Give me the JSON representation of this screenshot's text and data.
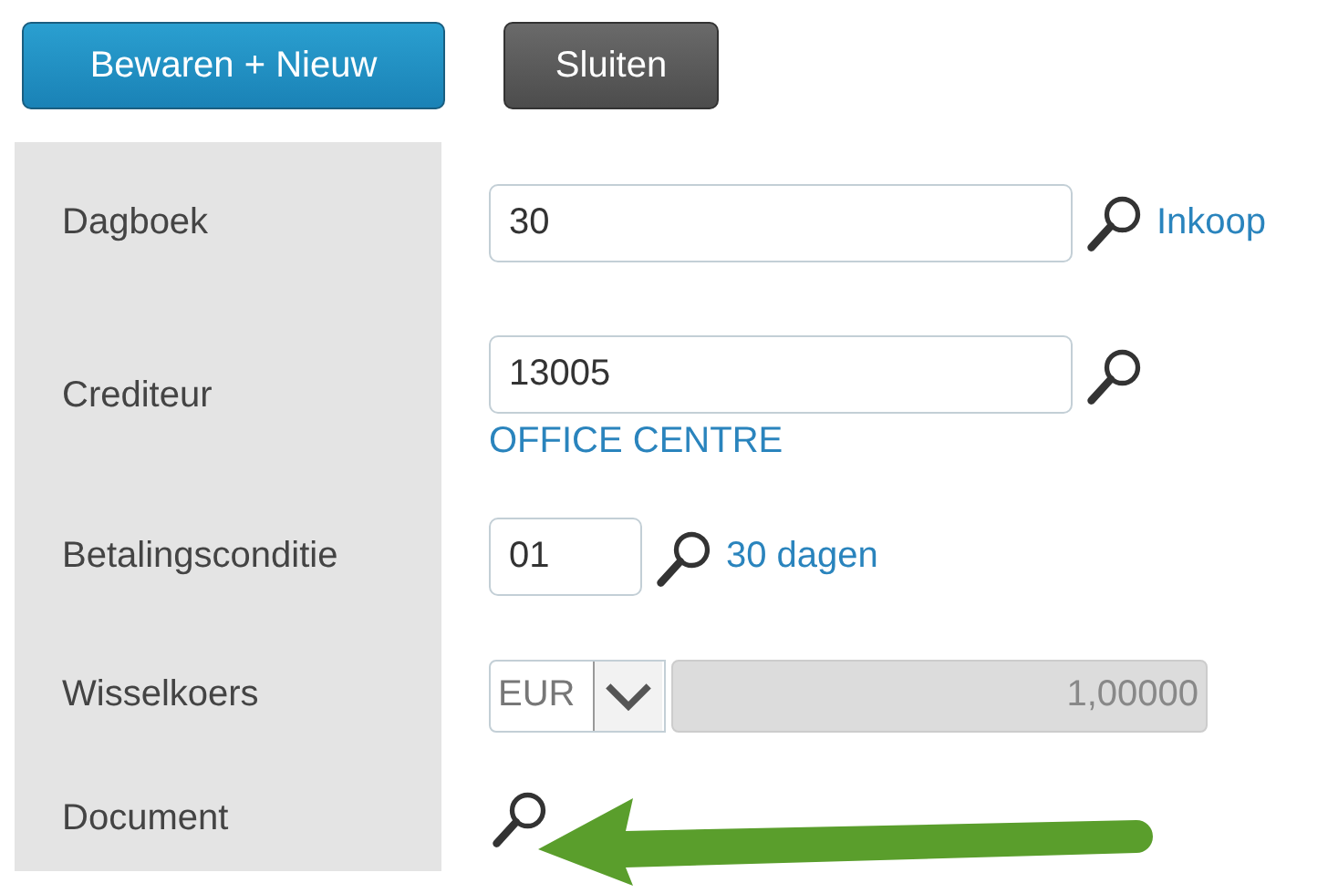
{
  "buttons": [
    {
      "label": "Bewaren + Nieuw",
      "kind": "primary"
    },
    {
      "label": "Sluiten",
      "kind": "secondary"
    }
  ],
  "fields": [
    {
      "label": "Dagboek",
      "kind": "lookup",
      "value": "30",
      "link": "Inkoop"
    },
    {
      "label": "Crediteur",
      "kind": "lookup",
      "value": "13005",
      "link": "OFFICE CENTRE"
    },
    {
      "label": "Betalingsconditie",
      "kind": "code",
      "value": "01",
      "link": "30 dagen"
    },
    {
      "label": "Wisselkoers",
      "kind": "currency",
      "currency": "EUR",
      "rate": "1,00000",
      "disabled": true
    },
    {
      "label": "Document",
      "kind": "document"
    }
  ]
}
